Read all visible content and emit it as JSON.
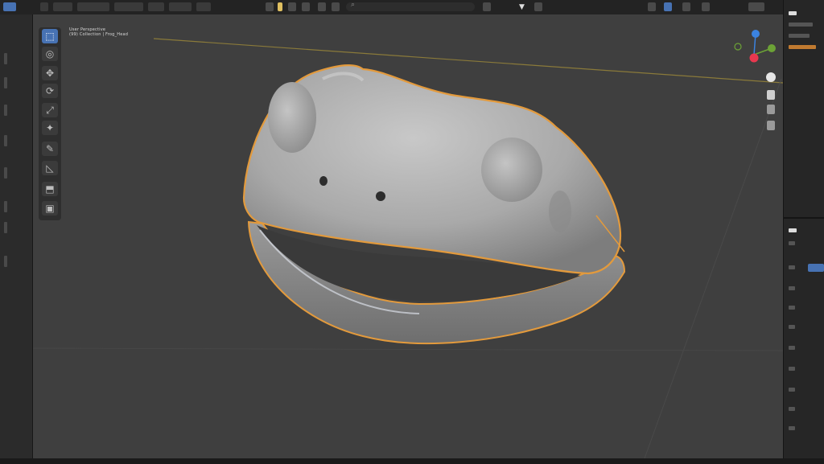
{
  "header": {
    "search_placeholder": ""
  },
  "viewport": {
    "info_line": "User Perspective",
    "object_label": "(99) Collection | Frog_Head"
  },
  "toolbar": {
    "tools": [
      {
        "name": "select-box-tool",
        "icon": "⬚",
        "active": true
      },
      {
        "name": "cursor-tool",
        "icon": "◎",
        "active": false
      },
      {
        "name": "move-tool",
        "icon": "✥",
        "active": false
      },
      {
        "name": "rotate-tool",
        "icon": "⟳",
        "active": false
      },
      {
        "name": "scale-tool",
        "icon": "⤢",
        "active": false
      },
      {
        "name": "transform-tool",
        "icon": "✦",
        "active": false
      },
      {
        "name": "annotate-tool",
        "icon": "✎",
        "active": false
      },
      {
        "name": "measure-tool",
        "icon": "◺",
        "active": false
      },
      {
        "name": "add-cube-tool",
        "icon": "⬒",
        "active": false
      },
      {
        "name": "extra-tool",
        "icon": "▣",
        "active": false
      }
    ]
  },
  "gizmo": {
    "axis_colors": {
      "x": "#e8384f",
      "y": "#6ca236",
      "z": "#3b83e0"
    }
  },
  "colors": {
    "accent": "#4772b3",
    "selection_outline": "#e39a3c",
    "mesh": "#b9b9b9",
    "viewport_bg": "#3f3f3f"
  }
}
